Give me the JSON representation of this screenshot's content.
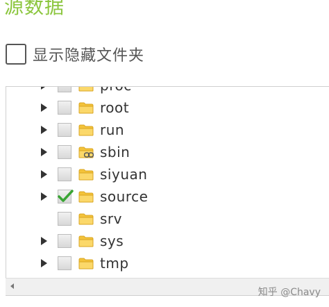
{
  "title": "源数据",
  "show_hidden": {
    "label": "显示隐藏文件夹",
    "checked": false
  },
  "tree": {
    "items": [
      {
        "name": "proc",
        "expandable": true,
        "checked": false,
        "icon": "folder-icon"
      },
      {
        "name": "root",
        "expandable": true,
        "checked": false,
        "icon": "folder-icon"
      },
      {
        "name": "run",
        "expandable": true,
        "checked": false,
        "icon": "folder-icon"
      },
      {
        "name": "sbin",
        "expandable": true,
        "checked": false,
        "icon": "folder-link-icon"
      },
      {
        "name": "siyuan",
        "expandable": true,
        "checked": false,
        "icon": "folder-icon"
      },
      {
        "name": "source",
        "expandable": true,
        "checked": true,
        "icon": "folder-icon"
      },
      {
        "name": "srv",
        "expandable": false,
        "checked": false,
        "icon": "folder-icon"
      },
      {
        "name": "sys",
        "expandable": true,
        "checked": false,
        "icon": "folder-icon"
      },
      {
        "name": "tmp",
        "expandable": true,
        "checked": false,
        "icon": "folder-icon"
      }
    ]
  },
  "watermark": "知乎 @Chavy",
  "colors": {
    "title": "#8cc63f",
    "folder": "#f4c33a",
    "check": "#3aa535"
  }
}
